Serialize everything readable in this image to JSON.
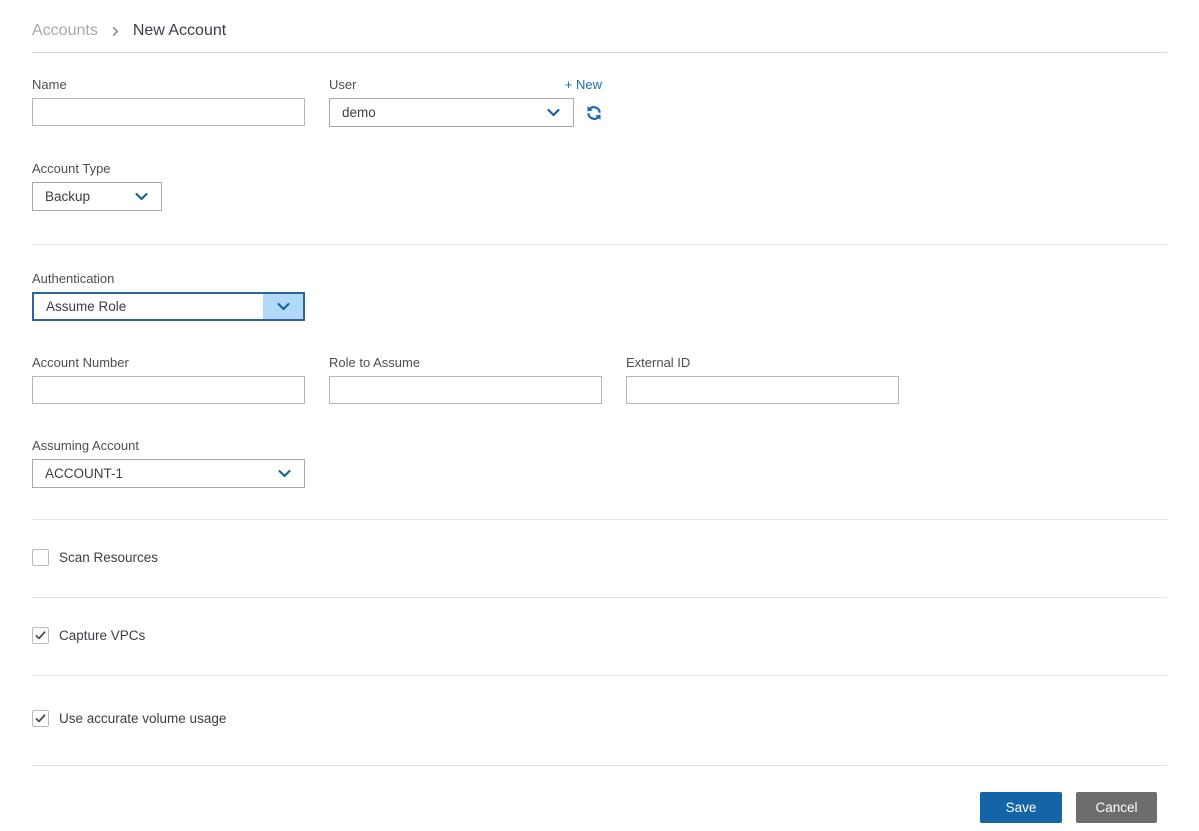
{
  "breadcrumb": {
    "parent": "Accounts",
    "current": "New Account"
  },
  "form": {
    "name": {
      "label": "Name",
      "value": ""
    },
    "user": {
      "label": "User",
      "value": "demo",
      "new_link": "+ New"
    },
    "account_type": {
      "label": "Account Type",
      "value": "Backup"
    },
    "authentication": {
      "label": "Authentication",
      "value": "Assume Role"
    },
    "account_number": {
      "label": "Account Number",
      "value": ""
    },
    "role_to_assume": {
      "label": "Role to Assume",
      "value": ""
    },
    "external_id": {
      "label": "External ID",
      "value": ""
    },
    "assuming_account": {
      "label": "Assuming Account",
      "value": "ACCOUNT-1"
    },
    "checkboxes": [
      {
        "label": "Scan Resources",
        "checked": false
      },
      {
        "label": "Capture VPCs",
        "checked": true
      },
      {
        "label": "Use accurate volume usage",
        "checked": true
      }
    ]
  },
  "footer": {
    "save_label": "Save",
    "cancel_label": "Cancel"
  },
  "icons": {
    "breadcrumb_chevron": "chevron-right",
    "select_chevron": "chevron-down",
    "refresh": "refresh-arrows",
    "checkmark": "check"
  },
  "colors": {
    "accent_blue": "#1465a7",
    "link_blue": "#1e6cb5",
    "chevron_blue": "#17629e",
    "focus_border_blue": "#2e6496",
    "focus_fill_blue": "#b0daf8",
    "cancel_gray": "#6d6d6d",
    "text_dark": "#3a3f44",
    "muted_gray": "#a9a9a9"
  }
}
